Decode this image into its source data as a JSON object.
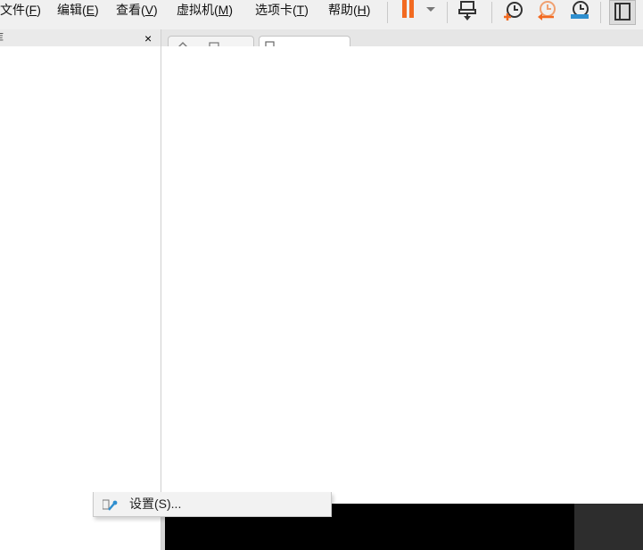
{
  "menubar": {
    "items": [
      {
        "label_main": "文件(",
        "mnemonic": "F",
        "label_end": ")"
      },
      {
        "label_main": "编辑(",
        "mnemonic": "E",
        "label_end": ")"
      },
      {
        "label_main": "查看(",
        "mnemonic": "V",
        "label_end": ")"
      },
      {
        "label_main": "虚拟机(",
        "mnemonic": "M",
        "label_end": ")"
      },
      {
        "label_main": "选项卡(",
        "mnemonic": "T",
        "label_end": ")"
      },
      {
        "label_main": "帮助(",
        "mnemonic": "H",
        "label_end": ")"
      }
    ]
  },
  "toolbar": {
    "icons": [
      "pause-icon",
      "dropdown-arrow-icon",
      "send-ctrl-alt-del-icon",
      "snapshot-take-icon",
      "snapshot-revert-icon",
      "snapshot-manager-icon",
      "view-layout-icon"
    ],
    "colors": {
      "pause": "#f26a21",
      "revert": "#f0a070",
      "manager": "#2f8fcf",
      "dark": "#333333"
    }
  },
  "library": {
    "close_glyph": "×",
    "title_fragment": "库"
  },
  "context_menu": {
    "item_label": "设置(S)..."
  },
  "colors": {
    "menubar_bg": "#f0f0f0",
    "vm_screen": "#000000",
    "vm_side": "#2d2d2d"
  }
}
